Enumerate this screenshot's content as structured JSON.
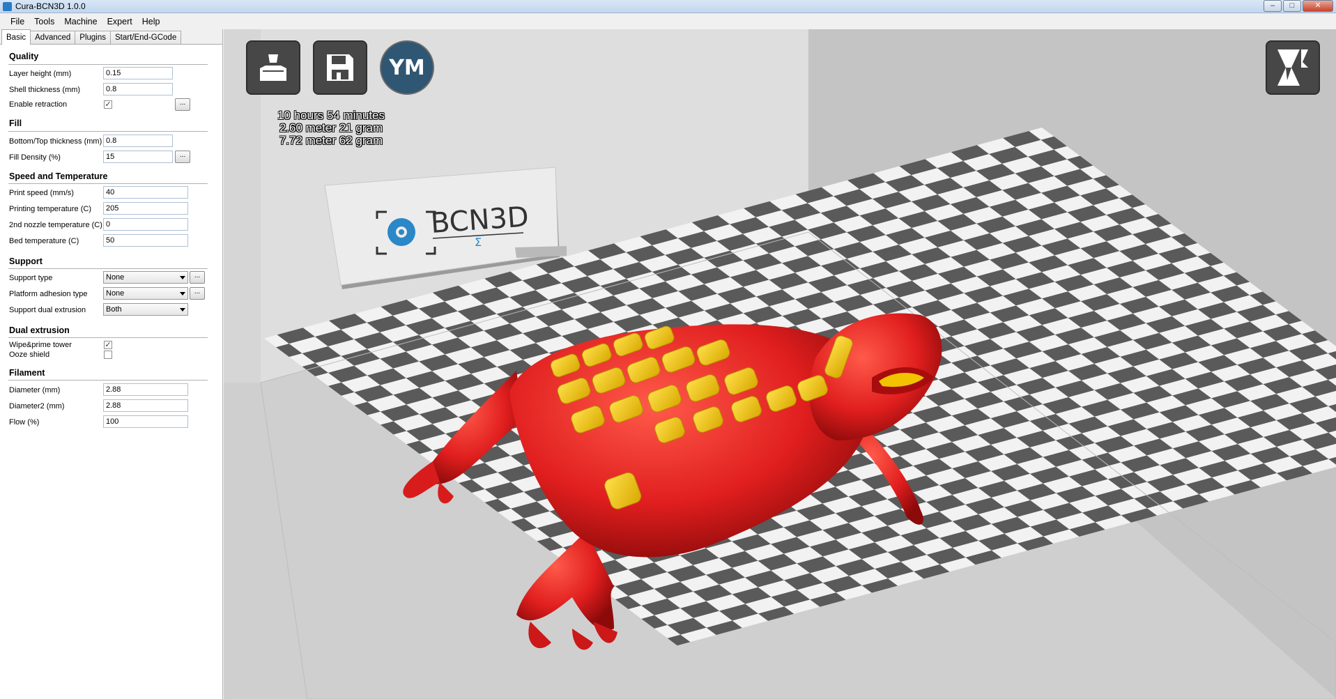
{
  "window": {
    "title": "Cura-BCN3D 1.0.0",
    "buttons": {
      "minimize": "–",
      "maximize": "□",
      "close": "✕"
    }
  },
  "menu": [
    "File",
    "Tools",
    "Machine",
    "Expert",
    "Help"
  ],
  "tabs": [
    "Basic",
    "Advanced",
    "Plugins",
    "Start/End-GCode"
  ],
  "settings": {
    "quality": {
      "title": "Quality",
      "layer_height_label": "Layer height (mm)",
      "layer_height": "0.15",
      "shell_thickness_label": "Shell thickness (mm)",
      "shell_thickness": "0.8",
      "retraction_label": "Enable retraction",
      "retraction_checked": "✓",
      "dots": "..."
    },
    "fill": {
      "title": "Fill",
      "bottom_top_label": "Bottom/Top thickness (mm)",
      "bottom_top": "0.8",
      "density_label": "Fill Density (%)",
      "density": "15",
      "dots": "..."
    },
    "speed": {
      "title": "Speed and Temperature",
      "print_speed_label": "Print speed (mm/s)",
      "print_speed": "40",
      "print_temp_label": "Printing temperature (C)",
      "print_temp": "205",
      "nozzle2_label": "2nd nozzle temperature (C)",
      "nozzle2": "0",
      "bed_label": "Bed temperature (C)",
      "bed": "50"
    },
    "support": {
      "title": "Support",
      "support_type_label": "Support type",
      "support_type": "None",
      "adhesion_label": "Platform adhesion type",
      "adhesion": "None",
      "dual_label": "Support dual extrusion",
      "dual": "Both",
      "dots": "..."
    },
    "dual_extrusion": {
      "title": "Dual extrusion",
      "wipe_label": "Wipe&prime tower",
      "wipe_checked": "✓",
      "ooze_label": "Ooze shield",
      "ooze_checked": ""
    },
    "filament": {
      "title": "Filament",
      "diameter_label": "Diameter (mm)",
      "diameter": "2.88",
      "diameter2_label": "Diameter2 (mm)",
      "diameter2": "2.88",
      "flow_label": "Flow (%)",
      "flow": "100"
    }
  },
  "viewport": {
    "ym_label": "YM",
    "print_time": "10 hours 54 minutes",
    "filament1": "2.60 meter 21 gram",
    "filament2": "7.72 meter 62 gram",
    "logo_text": "BCN3D",
    "logo_sub": "Σ",
    "icons": [
      "load-icon",
      "save-icon",
      "ym-icon",
      "view-mode-icon"
    ],
    "colors": {
      "model_primary": "#e62a2a",
      "model_secondary": "#f2c300",
      "logo_blue": "#2a87c8"
    }
  }
}
